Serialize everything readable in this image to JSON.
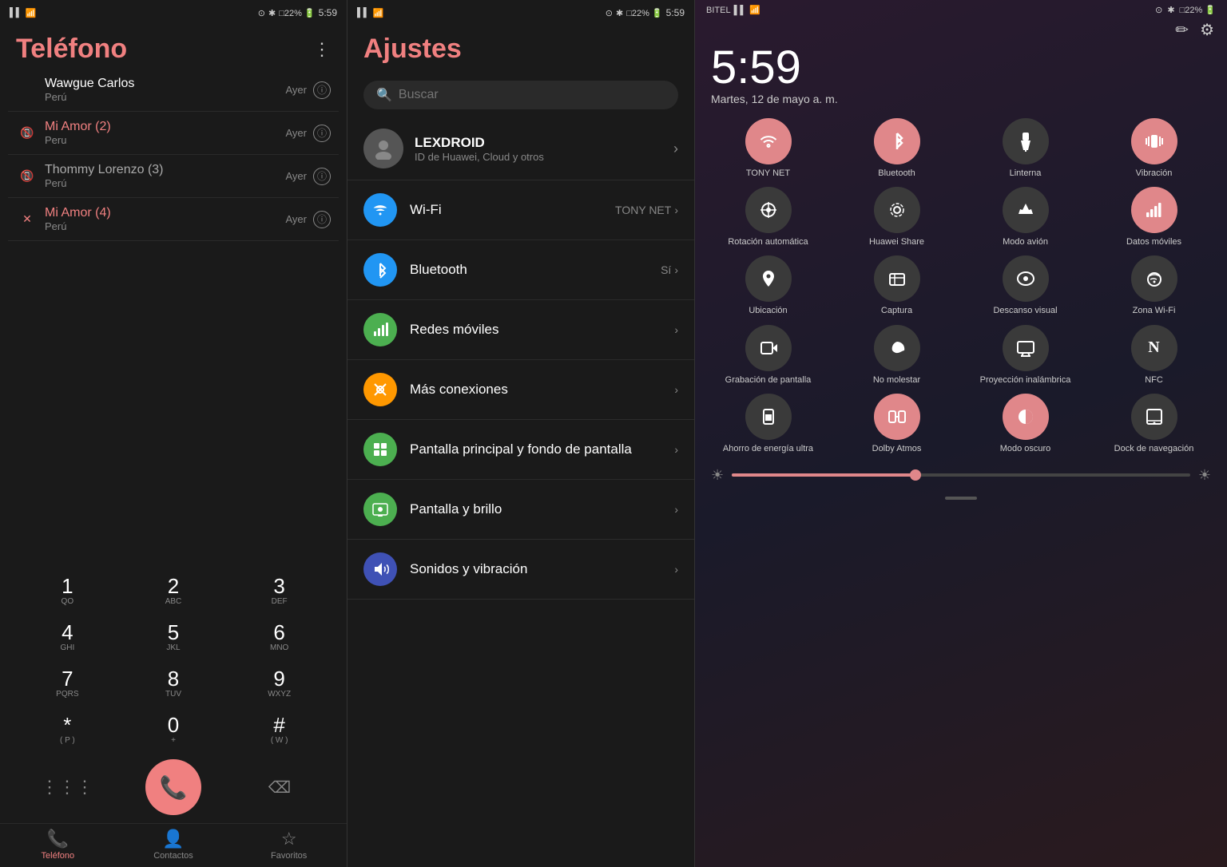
{
  "phone1": {
    "status_bar": {
      "signal": "▌▌",
      "wifi": "WiFi",
      "time": "5:59",
      "icons": "⊙ ✱ □22% 🔋"
    },
    "title": "Teléfono",
    "contacts": [
      {
        "name": "Wawgue Carlos",
        "subtitle": "Perú",
        "time": "Ayer",
        "type": "normal",
        "icon": ""
      },
      {
        "name": "Mi Amor (2)",
        "subtitle": "Peru",
        "time": "Ayer",
        "type": "missed",
        "icon": "📵"
      },
      {
        "name": "Thommy Lorenzo (3)",
        "subtitle": "Perú",
        "time": "Ayer",
        "type": "missed",
        "icon": "📵"
      },
      {
        "name": "Mi Amor (4)",
        "subtitle": "Perú",
        "time": "Ayer",
        "type": "blocked",
        "icon": "✕"
      }
    ],
    "dialpad": {
      "keys": [
        {
          "num": "1",
          "letters": "QO"
        },
        {
          "num": "2",
          "letters": "ABC"
        },
        {
          "num": "3",
          "letters": "DEF"
        },
        {
          "num": "4",
          "letters": "GHI"
        },
        {
          "num": "5",
          "letters": "JKL"
        },
        {
          "num": "6",
          "letters": "MNO"
        },
        {
          "num": "7",
          "letters": "PQRS"
        },
        {
          "num": "8",
          "letters": "TUV"
        },
        {
          "num": "9",
          "letters": "WXYZ"
        },
        {
          "num": "*",
          "letters": "( P )"
        },
        {
          "num": "0",
          "letters": "+"
        },
        {
          "num": "#",
          "letters": "( W )"
        }
      ]
    },
    "nav": {
      "items": [
        {
          "label": "Teléfono",
          "icon": "📞",
          "active": true
        },
        {
          "label": "Contactos",
          "icon": "👤",
          "active": false
        },
        {
          "label": "Favoritos",
          "icon": "☆",
          "active": false
        }
      ]
    }
  },
  "phone2": {
    "status_bar": {
      "time": "5:59"
    },
    "title": "Ajustes",
    "search_placeholder": "Buscar",
    "profile": {
      "name": "LEXDROID",
      "subtitle": "ID de Huawei, Cloud y otros"
    },
    "settings": [
      {
        "icon": "📶",
        "color": "#2196F3",
        "label": "Wi-Fi",
        "value": "TONY NET",
        "chevron": true
      },
      {
        "icon": "✱",
        "color": "#2196F3",
        "label": "Bluetooth",
        "value": "Sí",
        "chevron": true
      },
      {
        "icon": "📊",
        "color": "#4CAF50",
        "label": "Redes móviles",
        "value": "",
        "chevron": true
      },
      {
        "icon": "🔗",
        "color": "#FF9800",
        "label": "Más conexiones",
        "value": "",
        "chevron": true
      },
      {
        "icon": "🖼",
        "color": "#4CAF50",
        "label": "Pantalla principal y fondo de pantalla",
        "value": "",
        "chevron": true
      },
      {
        "icon": "📱",
        "color": "#4CAF50",
        "label": "Pantalla y brillo",
        "value": "",
        "chevron": true
      },
      {
        "icon": "🔊",
        "color": "#3F51B5",
        "label": "Sonidos y vibración",
        "value": "",
        "chevron": true
      }
    ]
  },
  "phone3": {
    "status_bar": {
      "carrier": "BITEL",
      "signal": "▌▌",
      "wifi": "WiFi",
      "icons": "⊙ ✱ □22% 🔋"
    },
    "time": "5:59",
    "date": "Martes, 12 de mayo  a. m.",
    "quick_tiles": [
      {
        "label": "TONY NET",
        "icon": "📶",
        "active": true
      },
      {
        "label": "Bluetooth",
        "icon": "✱",
        "active": true
      },
      {
        "label": "Linterna",
        "icon": "🔦",
        "active": false
      },
      {
        "label": "Vibración",
        "icon": "📳",
        "active": true
      },
      {
        "label": "Rotación automática",
        "icon": "⊘",
        "active": false
      },
      {
        "label": "Huawei Share",
        "icon": "((·))",
        "active": false
      },
      {
        "label": "Modo avión",
        "icon": "✈",
        "active": false
      },
      {
        "label": "Datos móviles",
        "icon": "📊",
        "active": true
      },
      {
        "label": "Ubicación",
        "icon": "📍",
        "active": false
      },
      {
        "label": "Captura",
        "icon": "✂",
        "active": false
      },
      {
        "label": "Descanso visual",
        "icon": "👁",
        "active": false
      },
      {
        "label": "Zona Wi-Fi",
        "icon": "((·))",
        "active": false
      },
      {
        "label": "Grabación de pantalla",
        "icon": "⏺",
        "active": false
      },
      {
        "label": "No molestar",
        "icon": "🌙",
        "active": false
      },
      {
        "label": "Proyección inalámbrica",
        "icon": "🖥",
        "active": false
      },
      {
        "label": "NFC",
        "icon": "N",
        "active": false
      },
      {
        "label": "Ahorro de energía ultra",
        "icon": "🔋",
        "active": false
      },
      {
        "label": "Dolby Atmos",
        "icon": "◫",
        "active": true
      },
      {
        "label": "Modo oscuro",
        "icon": "◑",
        "active": true
      },
      {
        "label": "Dock de navegación",
        "icon": "▣",
        "active": false
      }
    ],
    "brightness": 40,
    "pencil_icon": "✏",
    "gear_icon": "⚙"
  }
}
